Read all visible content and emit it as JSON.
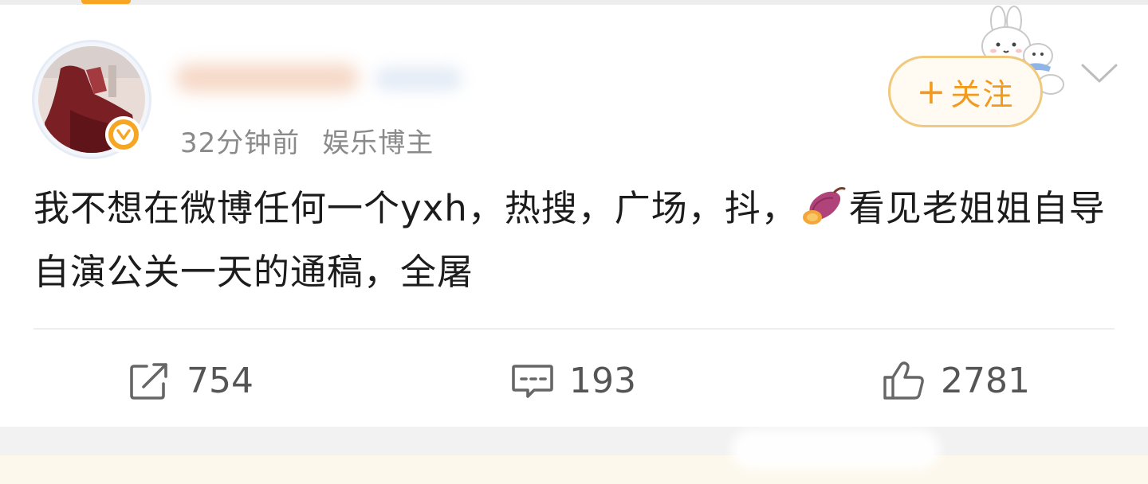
{
  "post": {
    "meta": {
      "time": "32分钟前",
      "role": "娱乐博主"
    },
    "follow_button": {
      "plus": "+",
      "label": "关注"
    },
    "text_part1": "我不想在微博任何一个yxh，热搜，广场，抖，",
    "emoji": "sweet-potato-emoji",
    "text_part2": "看见老姐姐自导自演公关一天的通稿，全屠",
    "actions": {
      "repost_count": "754",
      "comment_count": "193",
      "like_count": "2781"
    }
  },
  "colors": {
    "accent": "#f29a1d",
    "follow_border": "#f0c97e",
    "text": "#1c1c1c",
    "meta": "#8a8a8a",
    "action": "#555555"
  },
  "icons": {
    "verified": "verified-v-icon",
    "more": "chevron-down-icon",
    "repost": "share-arrow-icon",
    "comment": "comment-bubble-icon",
    "like": "thumbs-up-icon"
  }
}
